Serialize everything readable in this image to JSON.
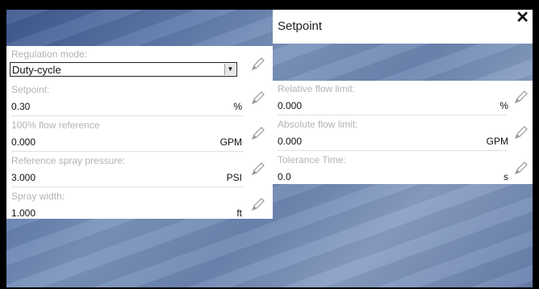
{
  "dialog": {
    "title": "Setpoint",
    "close": "✕"
  },
  "left": {
    "regulation_mode": {
      "label": "Regulation mode:",
      "value": "Duty-cycle"
    },
    "setpoint": {
      "label": "Setpoint:",
      "value": "0.30",
      "unit": "%"
    },
    "flow_reference": {
      "label": "100% flow reference",
      "value": "0.000",
      "unit": "GPM"
    },
    "spray_pressure": {
      "label": "Reference spray pressure:",
      "value": "3.000",
      "unit": "PSI"
    },
    "spray_width": {
      "label": "Spray width:",
      "value": "1.000",
      "unit": "ft"
    }
  },
  "right": {
    "relative_flow": {
      "label": "Relative flow limit:",
      "value": "0.000",
      "unit": "%"
    },
    "absolute_flow": {
      "label": "Absolute flow limit:",
      "value": "0.000",
      "unit": "GPM"
    },
    "tolerance_time": {
      "label": "Tolerance Time:",
      "value": "0.0",
      "unit": "s"
    }
  },
  "icons": {
    "edit": "pencil-icon",
    "dropdown": "dropdown-arrow-icon"
  }
}
